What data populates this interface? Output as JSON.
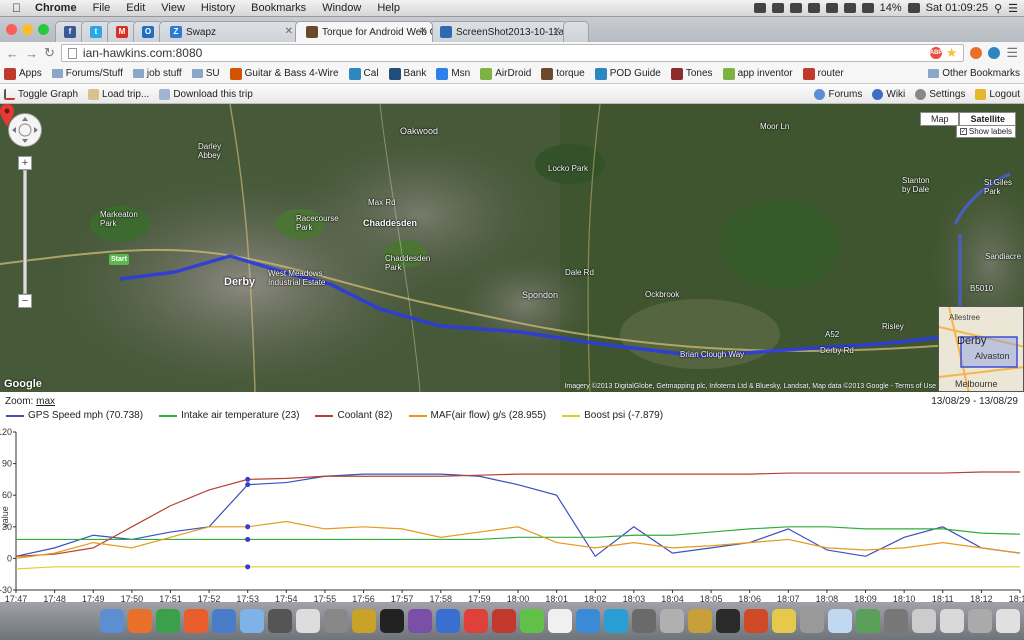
{
  "menubar": {
    "apple": "",
    "app_name": "Chrome",
    "menus": [
      "File",
      "Edit",
      "View",
      "History",
      "Bookmarks",
      "Window",
      "Help"
    ],
    "battery": "14%",
    "clock": "Sat 01:09:25"
  },
  "tabs": [
    {
      "label": "",
      "icon": "facebook-icon",
      "color": "#3b5998",
      "glyph": "f"
    },
    {
      "label": "",
      "icon": "twitter-icon",
      "color": "#2aa9e0",
      "glyph": "t"
    },
    {
      "label": "",
      "icon": "gmail-icon",
      "color": "#d93025",
      "glyph": "M"
    },
    {
      "label": "",
      "icon": "outlook-icon",
      "color": "#1f6fc0",
      "glyph": "O"
    },
    {
      "label": "Swapz",
      "icon": "swapz-icon",
      "color": "#2d7bd6",
      "glyph": "Z"
    },
    {
      "label": "Torque for Android Web G",
      "icon": "torque-icon",
      "color": "#6b4a2b",
      "glyph": "",
      "active": true
    },
    {
      "label": "ScreenShot2013-10-11at",
      "icon": "photobucket-icon",
      "color": "#2b6cb0",
      "glyph": ""
    }
  ],
  "address": {
    "url": "ian-hawkins.com:8080"
  },
  "bookmarks": [
    {
      "label": "Apps",
      "icon": "apps-icon"
    },
    {
      "label": "Forums/Stuff",
      "icon": "folder-icon"
    },
    {
      "label": "job stuff",
      "icon": "folder-icon"
    },
    {
      "label": "SU",
      "icon": "folder-icon"
    },
    {
      "label": "Guitar & Bass 4-Wire",
      "icon": "guitar-icon"
    },
    {
      "label": "Cal",
      "icon": "calendar-icon"
    },
    {
      "label": "Bank",
      "icon": "bank-icon"
    },
    {
      "label": "Msn",
      "icon": "msn-icon"
    },
    {
      "label": "AirDroid",
      "icon": "airdroid-icon"
    },
    {
      "label": "torque",
      "icon": "torque-icon"
    },
    {
      "label": "POD Guide",
      "icon": "pod-icon"
    },
    {
      "label": "Tones",
      "icon": "tones-icon"
    },
    {
      "label": "app inventor",
      "icon": "appinventor-icon"
    },
    {
      "label": "router",
      "icon": "router-icon"
    }
  ],
  "other_bookmarks": "Other Bookmarks",
  "app_toolbar": {
    "left": [
      "Toggle Graph",
      "Load trip...",
      "Download this trip"
    ],
    "right": [
      "Forums",
      "Wiki",
      "Settings",
      "Logout"
    ]
  },
  "map": {
    "type_buttons": [
      "Map",
      "Satellite"
    ],
    "selected_type": "Satellite",
    "show_labels": "Show labels",
    "start_label": "Start",
    "labels": [
      {
        "t": "Derby",
        "big": true
      },
      {
        "t": "Chaddesden"
      },
      {
        "t": "Oakwood"
      },
      {
        "t": "Spondon"
      },
      {
        "t": "Ockbrook"
      },
      {
        "t": "Risley"
      },
      {
        "t": "Darley Abbey"
      },
      {
        "t": "Markeaton Park"
      },
      {
        "t": "Racecourse Park"
      },
      {
        "t": "Chaddesden Park"
      },
      {
        "t": "Locko Park"
      },
      {
        "t": "West Meadows Industrial Estate"
      },
      {
        "t": "Stanton by Dale"
      },
      {
        "t": "St Giles Park"
      },
      {
        "t": "Sandiacre"
      },
      {
        "t": "Brian Clough Way"
      },
      {
        "t": "Derby Rd"
      },
      {
        "t": "Dale Rd"
      },
      {
        "t": "Moor Ln"
      },
      {
        "t": "Max Rd"
      },
      {
        "t": "A52"
      },
      {
        "t": "B5010"
      }
    ],
    "attribution": "Imagery ©2013 DigitalGlobe, Getmapping plc, Infoterra Ltd & Bluesky, Landsat, Map data ©2013 Google - Terms of Use",
    "overview_labels": [
      "Allestree",
      "Derby",
      "Alvaston",
      "Melbourne"
    ],
    "google": "Google"
  },
  "graph": {
    "zoom_label": "Zoom:",
    "zoom_value": "max",
    "date_range": "13/08/29 - 13/08/29",
    "ylabel": "value",
    "yticks": [
      "120",
      "90",
      "60",
      "30",
      "0",
      "-30"
    ],
    "xticks": [
      "17:47",
      "17:48",
      "17:49",
      "17:50",
      "17:51",
      "17:52",
      "17:53",
      "17:54",
      "17:55",
      "17:56",
      "17:57",
      "17:58",
      "17:59",
      "18:00",
      "18:01",
      "18:02",
      "18:03",
      "18:04",
      "18:05",
      "18:06",
      "18:07",
      "18:08",
      "18:09",
      "18:10",
      "18:11",
      "18:12",
      "18:13"
    ],
    "legend": [
      {
        "name": "GPS Speed mph (70.738)",
        "color": "#3a4fc0"
      },
      {
        "name": "Intake air temperature (23)",
        "color": "#2fae3a"
      },
      {
        "name": "Coolant (82)",
        "color": "#b5432c"
      },
      {
        "name": "MAF(air flow) g/s (28.955)",
        "color": "#e49a1d"
      },
      {
        "name": "Boost psi (-7.879)",
        "color": "#d7d22a"
      }
    ]
  },
  "chart_data": {
    "type": "line",
    "ylim": [
      -30,
      120
    ],
    "xlabel": "",
    "ylabel": "value",
    "x": [
      "17:47",
      "17:48",
      "17:49",
      "17:50",
      "17:51",
      "17:52",
      "17:53",
      "17:54",
      "17:55",
      "17:56",
      "17:57",
      "17:58",
      "17:59",
      "18:00",
      "18:01",
      "18:02",
      "18:03",
      "18:04",
      "18:05",
      "18:06",
      "18:07",
      "18:08",
      "18:09",
      "18:10",
      "18:11",
      "18:12",
      "18:13"
    ],
    "series": [
      {
        "name": "GPS Speed mph (70.738)",
        "values": [
          2,
          10,
          22,
          18,
          25,
          30,
          70,
          72,
          78,
          80,
          80,
          80,
          78,
          70,
          60,
          2,
          30,
          5,
          10,
          15,
          28,
          8,
          2,
          20,
          30,
          10,
          5
        ]
      },
      {
        "name": "Intake air temperature (23)",
        "values": [
          18,
          18,
          18,
          18,
          18,
          18,
          18,
          18,
          18,
          18,
          18,
          18,
          18,
          20,
          20,
          20,
          22,
          22,
          25,
          28,
          30,
          30,
          28,
          28,
          28,
          24,
          23
        ]
      },
      {
        "name": "Coolant (82)",
        "values": [
          2,
          4,
          10,
          30,
          50,
          65,
          75,
          76,
          78,
          78,
          78,
          78,
          79,
          80,
          80,
          80,
          80,
          80,
          80,
          80,
          81,
          81,
          81,
          81,
          81,
          82,
          82
        ]
      },
      {
        "name": "MAF(air flow) g/s (28.955)",
        "values": [
          0,
          5,
          15,
          10,
          20,
          30,
          30,
          35,
          28,
          30,
          28,
          20,
          25,
          30,
          15,
          10,
          15,
          10,
          12,
          15,
          18,
          10,
          8,
          10,
          15,
          10,
          5
        ]
      },
      {
        "name": "Boost psi (-7.879)",
        "values": [
          -10,
          -8,
          -8,
          -8,
          -8,
          -8,
          -8,
          -8,
          -8,
          -8,
          -8,
          -8,
          -8,
          -8,
          -8,
          -8,
          -8,
          -8,
          -8,
          -8,
          -8,
          -8,
          -8,
          -8,
          -8,
          -8,
          -8
        ]
      }
    ]
  },
  "dock": {
    "count": 34
  }
}
